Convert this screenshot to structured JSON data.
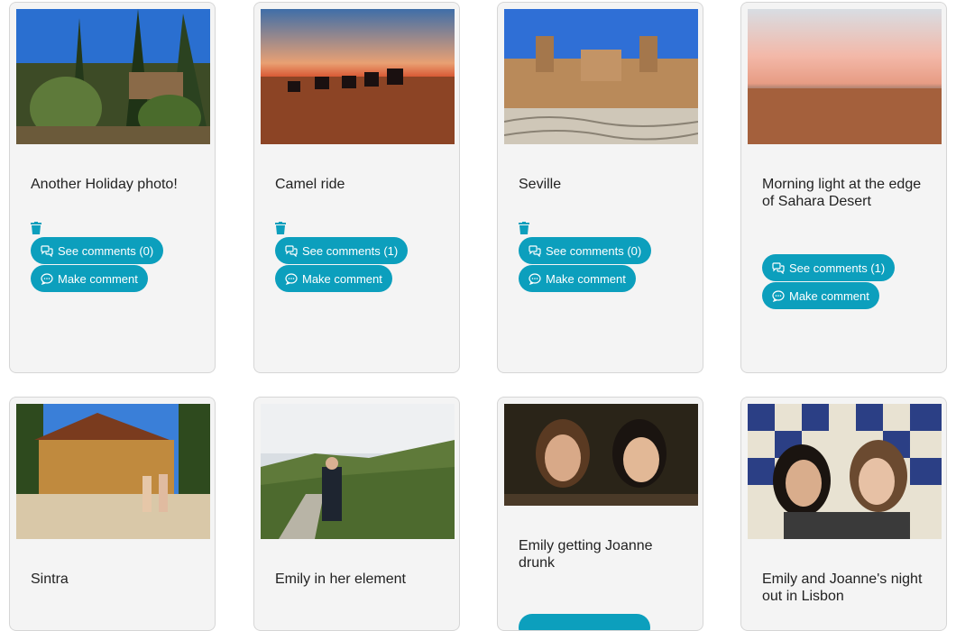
{
  "cards": [
    {
      "title": "Another Holiday photo!",
      "see_comments": "See comments (0)",
      "make_comment": "Make comment",
      "photo_icon": "garden-photo"
    },
    {
      "title": "Camel ride",
      "see_comments": "See comments (1)",
      "make_comment": "Make comment",
      "photo_icon": "desert-camels-photo"
    },
    {
      "title": "Seville",
      "see_comments": "See comments (0)",
      "make_comment": "Make comment",
      "photo_icon": "plaza-photo"
    },
    {
      "title": "Morning light at the edge of Sahara Desert",
      "see_comments": "See comments (1)",
      "make_comment": "Make comment",
      "photo_icon": "sahara-dawn-photo"
    },
    {
      "title": "Sintra",
      "photo_icon": "sintra-house-photo"
    },
    {
      "title": "Emily in her element",
      "photo_icon": "hiking-trail-photo"
    },
    {
      "title": "Emily getting Joanne drunk",
      "photo_icon": "bar-selfie-photo"
    },
    {
      "title": "Emily and Joanne's night out in Lisbon",
      "photo_icon": "tiles-selfie-photo"
    }
  ],
  "colors": {
    "accent": "#0c9fbd",
    "card_bg": "#f4f4f4",
    "border": "#d6d6d6"
  }
}
